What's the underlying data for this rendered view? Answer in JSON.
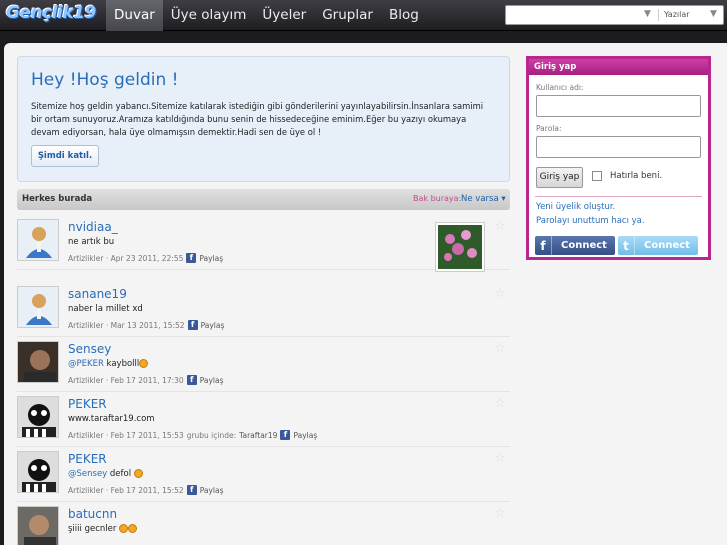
{
  "header": {
    "logo": "Gençlik19",
    "nav": [
      {
        "label": "Duvar",
        "active": true
      },
      {
        "label": "Üye olayım",
        "active": false
      },
      {
        "label": "Üyeler",
        "active": false
      },
      {
        "label": "Gruplar",
        "active": false
      },
      {
        "label": "Blog",
        "active": false
      }
    ],
    "search": {
      "placeholder": "",
      "scope_label": "Yazılar"
    }
  },
  "welcome": {
    "title": "Hey !Hoş geldin !",
    "body": "Sitemize hoş geldin yabancı.Sitemize katılarak istediğin gibi gönderilerini yayınlayabilirsin.İnsanlara samimi bir ortam sunuyoruz.Aramıza katıldığında bunu senin de hissedeceğine eminim.Eğer bu yazıyı okumaya devam ediyorsan, hala üye olmamışsın demektir.Hadi sen de üye ol !",
    "join_button": "Şimdi katıl."
  },
  "feed": {
    "title": "Herkes burada",
    "filter_label": "Bak buraya:",
    "filter_value": "Ne varsa ▾",
    "share_label": "Paylaş",
    "posts": [
      {
        "name": "nvidiaa_",
        "text": "ne artık bu",
        "meta": "Artizlikler · Apr 23 2011, 22:55",
        "avatar": "default"
      },
      {
        "name": "sanane19",
        "text": "naber la millet xd",
        "meta": "Artizlikler · Mar 13 2011, 15:52",
        "avatar": "default"
      },
      {
        "name": "Sensey",
        "mention": "@PEKER",
        "text": " kaybolll",
        "meta": "Artizlikler · Feb 17 2011, 17:30",
        "avatar": "photo"
      },
      {
        "name": "PEKER",
        "text": "www.taraftar19.com",
        "meta": "Artizlikler · Feb 17 2011, 15:53",
        "group_note": "grubu içinde:",
        "group": "Taraftar19",
        "avatar": "bw"
      },
      {
        "name": "PEKER",
        "mention": "@Sensey",
        "text": " defol",
        "meta": "Artizlikler · Feb 17 2011, 15:52",
        "avatar": "bw"
      },
      {
        "name": "batucnn",
        "text": "şiiii gecnler",
        "meta": "",
        "avatar": "photo2"
      }
    ]
  },
  "login": {
    "title": "Giriş yap",
    "username_label": "Kullanıcı adı:",
    "password_label": "Parola:",
    "submit": "Giriş yap",
    "remember": "Hatırla beni.",
    "register_link": "Yeni üyelik oluştur.",
    "forgot_link": "Parolayı unuttum hacı ya.",
    "facebook_connect": "Connect",
    "twitter_connect": "Connect"
  }
}
